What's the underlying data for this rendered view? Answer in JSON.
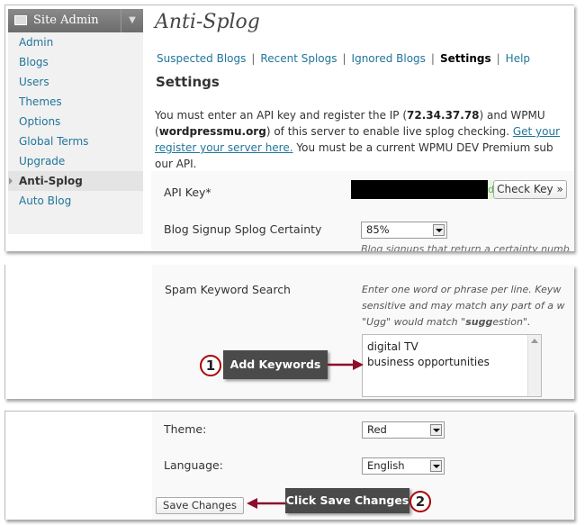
{
  "sidebar": {
    "title": "Site Admin",
    "items": [
      {
        "label": "Admin"
      },
      {
        "label": "Blogs"
      },
      {
        "label": "Users"
      },
      {
        "label": "Themes"
      },
      {
        "label": "Options"
      },
      {
        "label": "Global Terms"
      },
      {
        "label": "Upgrade"
      },
      {
        "label": "Anti-Splog",
        "active": true
      },
      {
        "label": "Auto Blog"
      }
    ]
  },
  "page": {
    "title": "Anti-Splog",
    "subnav": [
      "Suspected Blogs",
      "Recent Splogs",
      "Ignored Blogs",
      "Settings",
      "Help"
    ],
    "current_tab": "Settings",
    "heading": "Settings",
    "intro": {
      "line1_a": "You must enter an API key and register the IP (",
      "ip": "72.34.37.78",
      "line1_b": ") and WPMU",
      "line2_a": "(",
      "domain": "wordpressmu.org",
      "line2_b": ") of this server to enable live splog checking. ",
      "link1": "Get your",
      "link2": "register your server here.",
      "line3_b": " You must be a current WPMU DEV Premium sub",
      "line4": "our API."
    }
  },
  "form": {
    "api_key_label": "API Key*",
    "api_key_tail": "d",
    "check_key_button": "Check Key »",
    "certainty_label": "Blog Signup Splog Certainty",
    "certainty_value": "85%",
    "certainty_hint": "Blog signups that return a certainty numb",
    "keyword_label": "Spam Keyword Search",
    "keyword_hint_1": "Enter one word or phrase per line. Keyw",
    "keyword_hint_2": "sensitive and may match any part of a w",
    "keyword_hint_3a": "\"Ugg\" would match \"",
    "keyword_hint_3b": "sugg",
    "keyword_hint_3c": "estion\".",
    "keywords": [
      "digital TV",
      "business opportunities"
    ],
    "theme_label": "Theme:",
    "theme_value": "Red",
    "language_label": "Language:",
    "language_value": "English",
    "save_button": "Save Changes"
  },
  "callouts": {
    "step1_number": "1",
    "step1_text": "Add Keywords",
    "step2_number": "2",
    "step2_text": "Click Save Changes"
  },
  "colors": {
    "link": "#21759b",
    "callout_bg": "#4a4a4a",
    "arrow": "#8b0f2a"
  }
}
